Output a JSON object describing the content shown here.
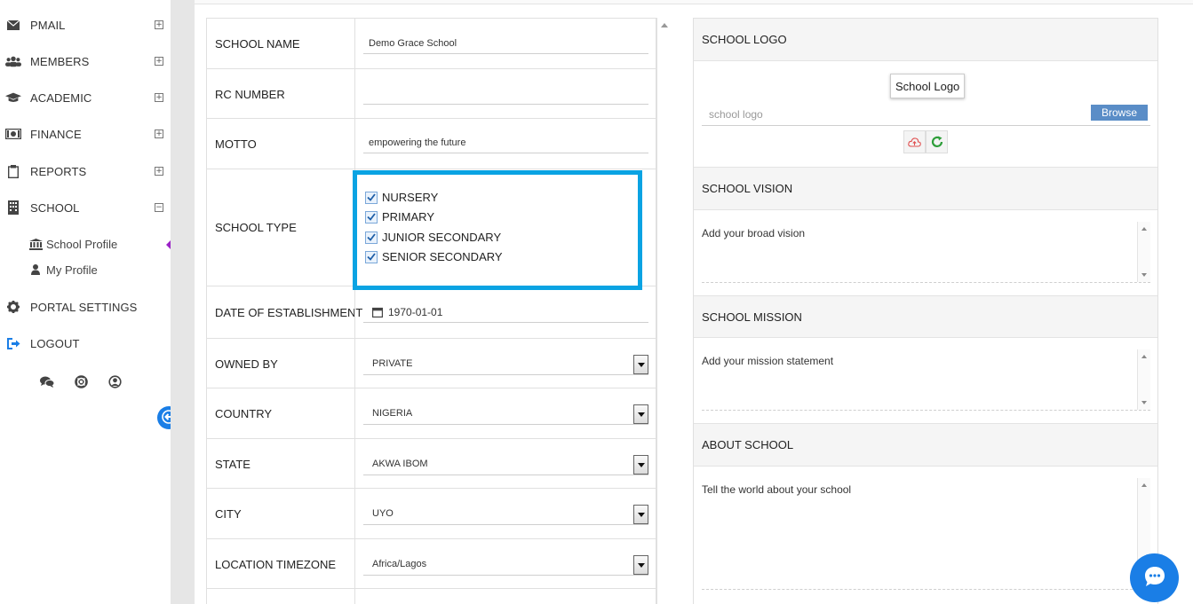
{
  "sidebar": {
    "items": [
      {
        "label": "PMAIL",
        "icon": "envelope-icon",
        "toggle": "+"
      },
      {
        "label": "MEMBERS",
        "icon": "users-icon",
        "toggle": "+"
      },
      {
        "label": "ACADEMIC",
        "icon": "graduation-cap-icon",
        "toggle": "+"
      },
      {
        "label": "FINANCE",
        "icon": "money-icon",
        "toggle": "+"
      },
      {
        "label": "REPORTS",
        "icon": "clipboard-icon",
        "toggle": "+"
      },
      {
        "label": "SCHOOL",
        "icon": "building-icon",
        "toggle": "−"
      }
    ],
    "subitems": [
      {
        "label": "School Profile",
        "icon": "institution-icon"
      },
      {
        "label": "My Profile",
        "icon": "user-icon"
      }
    ],
    "bottom_items": [
      {
        "label": "PORTAL SETTINGS",
        "icon": "gear-icon"
      },
      {
        "label": "LOGOUT",
        "icon": "sign-out-icon"
      }
    ],
    "footer_icons": [
      "comments-icon",
      "life-ring-icon",
      "user-circle-icon"
    ]
  },
  "form": {
    "school_name": {
      "label": "SCHOOL NAME",
      "value": "Demo Grace School"
    },
    "rc_number": {
      "label": "RC NUMBER",
      "value": ""
    },
    "motto": {
      "label": "MOTTO",
      "value": "empowering the future"
    },
    "school_type": {
      "label": "SCHOOL TYPE",
      "options": [
        {
          "label": "NURSERY",
          "checked": true
        },
        {
          "label": "PRIMARY",
          "checked": true
        },
        {
          "label": "JUNIOR SECONDARY",
          "checked": true
        },
        {
          "label": "SENIOR SECONDARY",
          "checked": true
        }
      ]
    },
    "date_of_establishment": {
      "label": "DATE OF ESTABLISHMENT",
      "value": "1970-01-01"
    },
    "owned_by": {
      "label": "OWNED BY",
      "value": "PRIVATE"
    },
    "country": {
      "label": "COUNTRY",
      "value": "NIGERIA"
    },
    "state": {
      "label": "STATE",
      "value": "AKWA IBOM"
    },
    "city": {
      "label": "CITY",
      "value": "UYO"
    },
    "location_timezone": {
      "label": "LOCATION TIMEZONE",
      "value": "Africa/Lagos"
    }
  },
  "right": {
    "logo": {
      "heading": "SCHOOL LOGO",
      "tag": "School Logo",
      "placeholder": "school logo",
      "browse": "Browse"
    },
    "vision": {
      "heading": "SCHOOL VISION",
      "placeholder": "Add your broad vision"
    },
    "mission": {
      "heading": "SCHOOL MISSION",
      "placeholder": "Add your mission statement"
    },
    "about": {
      "heading": "ABOUT SCHOOL",
      "placeholder": "Tell the world about your school"
    }
  },
  "colors": {
    "accent": "#1a7ee6",
    "highlight": "#0aa3e3",
    "active_caret": "#9b22c7",
    "browse": "#5a8dc7"
  }
}
